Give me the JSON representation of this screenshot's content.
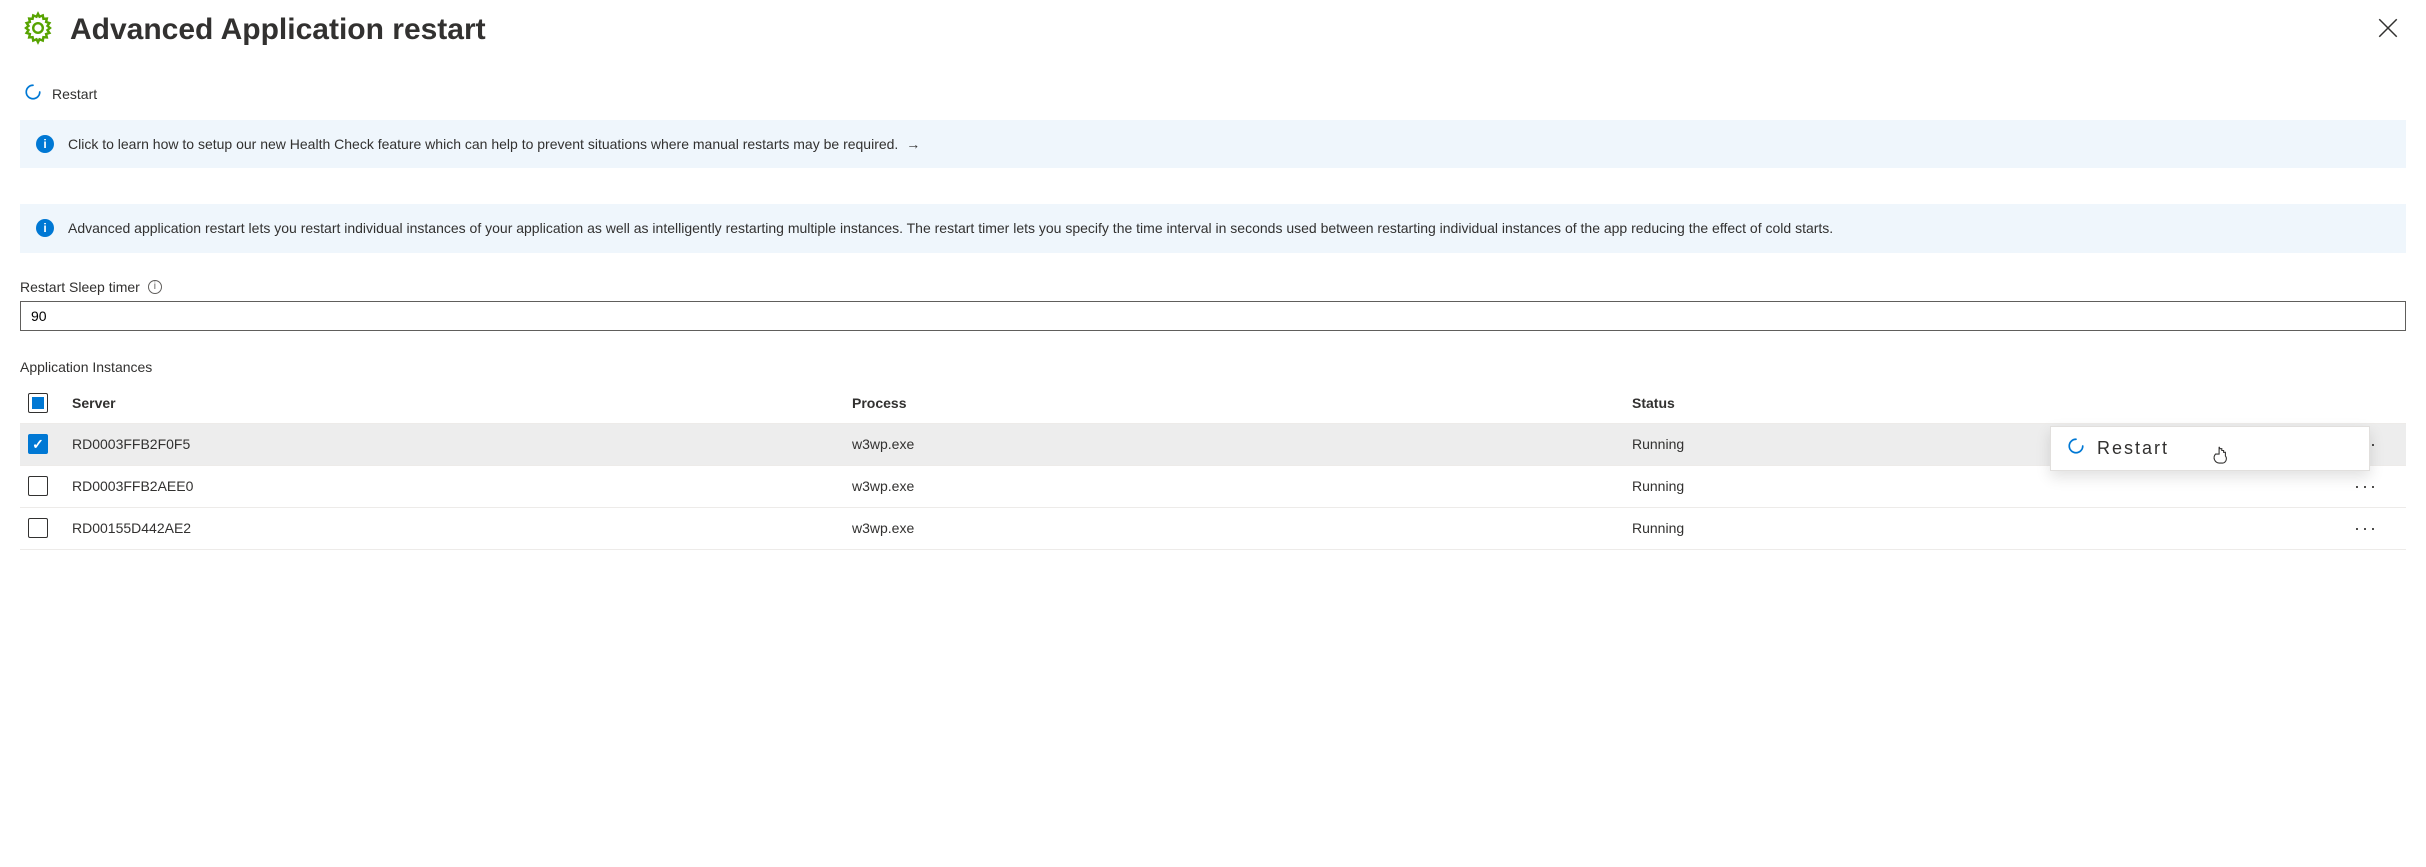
{
  "header": {
    "title": "Advanced Application restart"
  },
  "toolbar": {
    "restart_label": "Restart"
  },
  "banners": {
    "health_check": "Click to learn how to setup our new Health Check feature which can help to prevent situations where manual restarts may be required.",
    "description": "Advanced application restart lets you restart individual instances of your application as well as intelligently restarting multiple instances. The restart timer lets you specify the time interval in seconds used between restarting individual instances of the app reducing the effect of cold starts."
  },
  "fields": {
    "sleep_timer_label": "Restart Sleep timer",
    "sleep_timer_value": "90"
  },
  "table": {
    "title": "Application Instances",
    "headers": {
      "server": "Server",
      "process": "Process",
      "status": "Status"
    },
    "rows": [
      {
        "server": "RD0003FFB2F0F5",
        "process": "w3wp.exe",
        "status": "Running",
        "selected": true
      },
      {
        "server": "RD0003FFB2AEE0",
        "process": "w3wp.exe",
        "status": "Running",
        "selected": false
      },
      {
        "server": "RD00155D442AE2",
        "process": "w3wp.exe",
        "status": "Running",
        "selected": false
      }
    ]
  },
  "context_menu": {
    "restart_label": "Restart"
  },
  "icons": {
    "gear": "gear-icon",
    "close": "close-icon",
    "restart": "restart-icon",
    "info": "info-icon",
    "help": "help-icon",
    "more": "more-icon",
    "arrow": "→"
  },
  "colors": {
    "accent": "#0078d4",
    "gear": "#57a300",
    "banner_bg": "#eff6fc"
  }
}
